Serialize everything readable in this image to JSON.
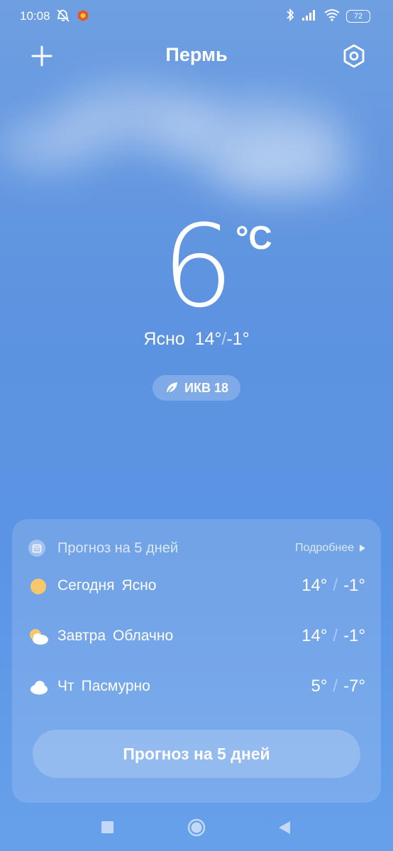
{
  "status_bar": {
    "time": "10:08",
    "left_icons": [
      "alarm-off-icon",
      "app-notification-icon"
    ],
    "right_icons": [
      "bluetooth-icon",
      "signal-icon",
      "wifi-icon"
    ],
    "battery": "72"
  },
  "header": {
    "city": "Пермь"
  },
  "current": {
    "temperature": "6",
    "unit": "°C",
    "condition": "Ясно",
    "high": "14°",
    "separator": "/",
    "low": "-1°",
    "aqi_label": "ИКВ 18"
  },
  "forecast": {
    "title": "Прогноз на 5 дней",
    "more_label": "Подробнее",
    "days": [
      {
        "day": "Сегодня",
        "condition": "Ясно",
        "high": "14°",
        "low": "-1°",
        "icon": "sun-icon"
      },
      {
        "day": "Завтра",
        "condition": "Облачно",
        "high": "14°",
        "low": "-1°",
        "icon": "partly-cloudy-icon"
      },
      {
        "day": "Чт",
        "condition": "Пасмурно",
        "high": "5°",
        "low": "-7°",
        "icon": "cloud-icon"
      }
    ],
    "separator": "/",
    "button_label": "Прогноз на 5 дней"
  },
  "nav": {
    "icons": [
      "recent-apps-icon",
      "home-icon",
      "back-icon"
    ]
  },
  "colors": {
    "sky_top": "#6e9fe1",
    "sky_bottom": "#67a0ea",
    "sun": "#f6c86a"
  }
}
